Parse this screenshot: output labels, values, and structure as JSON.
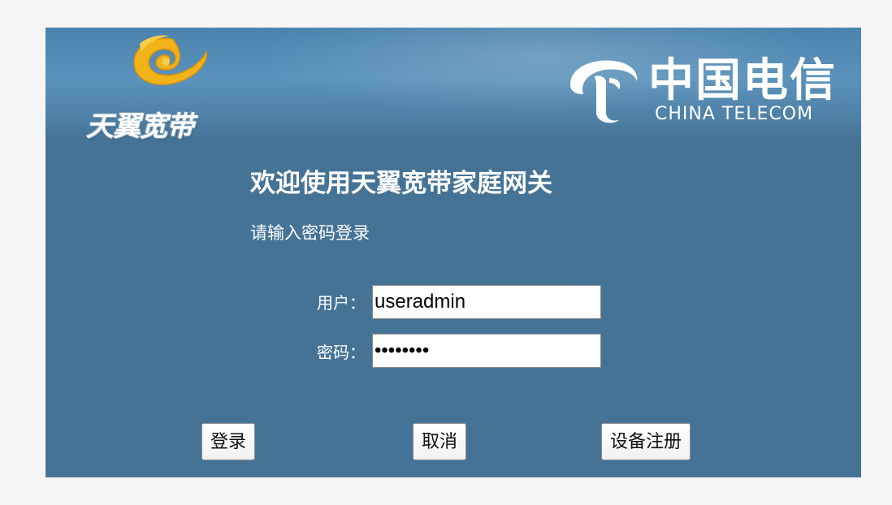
{
  "banner": {
    "brand_text": "天翼宽带",
    "telecom_cn": "中国电信",
    "telecom_en": "CHINA TELECOM"
  },
  "login": {
    "welcome": "欢迎使用天翼宽带家庭网关",
    "subtitle": "请输入密码登录",
    "username_label": "用户：",
    "username_value": "useradmin",
    "password_label": "密码：",
    "password_value": "••••••••"
  },
  "buttons": {
    "login": "登录",
    "cancel": "取消",
    "register": "设备注册"
  },
  "colors": {
    "panel_bg": "#457396",
    "page_bg": "#f5f5f5",
    "logo_gold": "#f2b21a"
  },
  "icons": {
    "brand_logo": "tianyi-broadband-swirl-logo",
    "telecom_logo": "china-telecom-logo"
  }
}
